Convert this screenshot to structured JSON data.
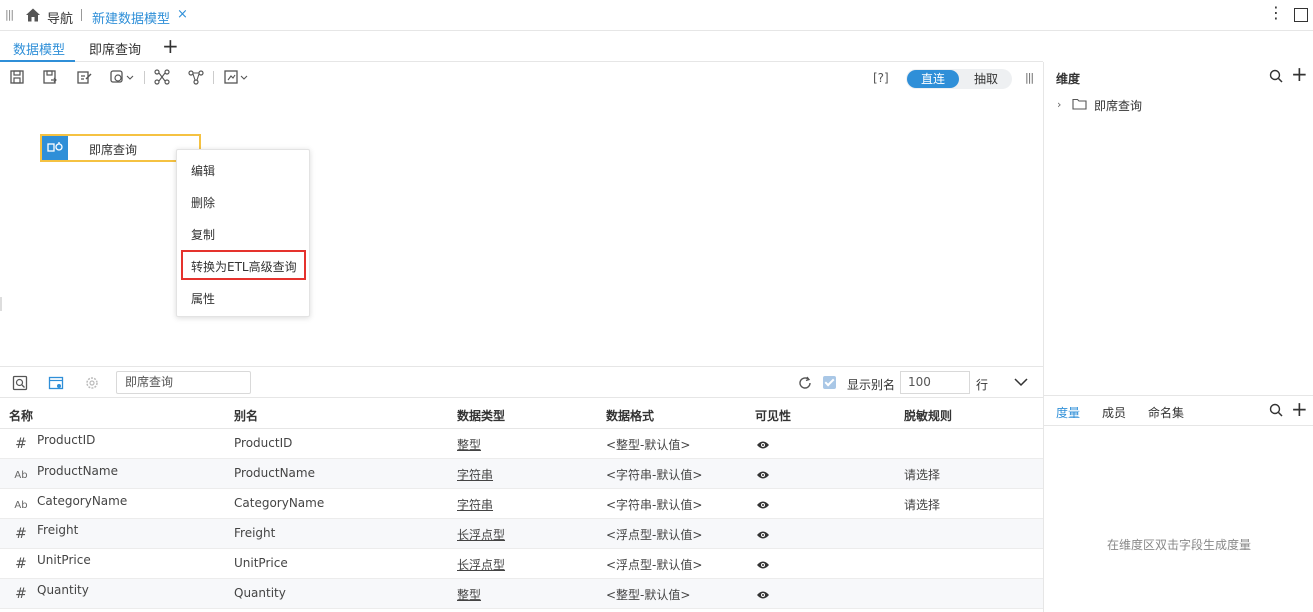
{
  "topbar": {
    "nav_label": "导航",
    "tab_title": "新建数据模型",
    "close": "×",
    "more": "⋮"
  },
  "subtabs": {
    "model": "数据模型",
    "query": "即席查询",
    "add": "+"
  },
  "toolbar": {
    "help": "[?]",
    "mode_on": "直连",
    "mode_off": "抽取",
    "accent": "#2f8fd8"
  },
  "canvas": {
    "node_label": "即席查询",
    "node_border_color": "#f5c242",
    "context_menu": [
      "编辑",
      "删除",
      "复制",
      "转换为ETL高级查询",
      "属性"
    ],
    "highlight_color": "#e5322d"
  },
  "fieldbar": {
    "search_value": "即席查询",
    "show_alias_label": "显示别名",
    "show_alias_checked": true,
    "rows_value": "100",
    "rows_unit": "行"
  },
  "table": {
    "columns": [
      "名称",
      "别名",
      "数据类型",
      "数据格式",
      "可见性",
      "脱敏规则"
    ],
    "rows": [
      {
        "icon": "number-icon",
        "icon_glyph": "#",
        "name": "ProductID",
        "alias": "ProductID",
        "type": "整型",
        "format": "<整型-默认值>",
        "visible": true,
        "masking": ""
      },
      {
        "icon": "text-type-icon",
        "icon_glyph": "Ab",
        "name": "ProductName",
        "alias": "ProductName",
        "type": "字符串",
        "format": "<字符串-默认值>",
        "visible": true,
        "masking": "请选择"
      },
      {
        "icon": "text-type-icon",
        "icon_glyph": "Ab",
        "name": "CategoryName",
        "alias": "CategoryName",
        "type": "字符串",
        "format": "<字符串-默认值>",
        "visible": true,
        "masking": "请选择"
      },
      {
        "icon": "number-icon",
        "icon_glyph": "#",
        "name": "Freight",
        "alias": "Freight",
        "type": "长浮点型",
        "format": "<浮点型-默认值>",
        "visible": true,
        "masking": ""
      },
      {
        "icon": "number-icon",
        "icon_glyph": "#",
        "name": "UnitPrice",
        "alias": "UnitPrice",
        "type": "长浮点型",
        "format": "<浮点型-默认值>",
        "visible": true,
        "masking": ""
      },
      {
        "icon": "number-icon",
        "icon_glyph": "#",
        "name": "Quantity",
        "alias": "Quantity",
        "type": "整型",
        "format": "<整型-默认值>",
        "visible": true,
        "masking": ""
      }
    ]
  },
  "right_panel": {
    "dimension_title": "维度",
    "tree_item": "即席查询",
    "tabs": [
      "度量",
      "成员",
      "命名集"
    ],
    "empty_hint": "在维度区双击字段生成度量"
  }
}
